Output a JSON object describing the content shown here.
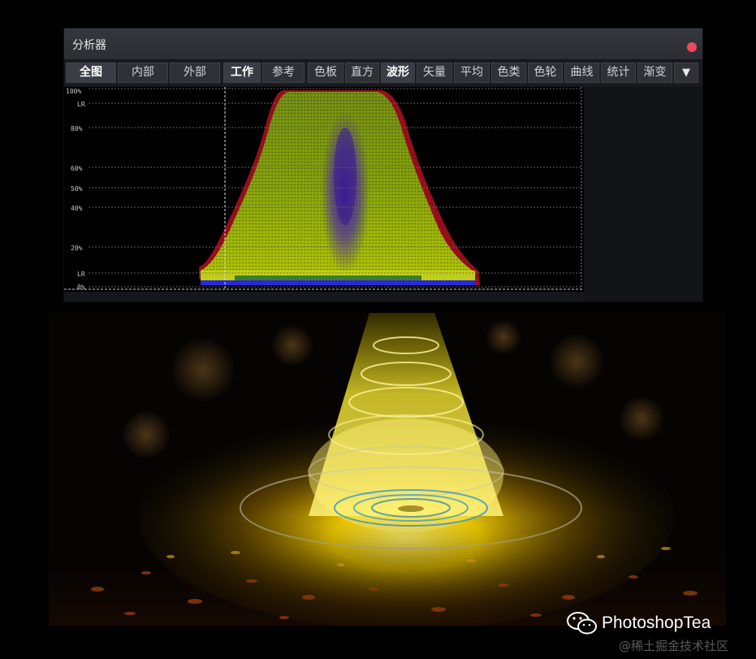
{
  "window": {
    "title": "分析器",
    "close_color": "#ec4a59"
  },
  "tabs": [
    {
      "label": "全图",
      "active": true
    },
    {
      "label": "内部",
      "active": false
    },
    {
      "label": "外部",
      "active": false
    },
    {
      "label": "工作",
      "active": true
    },
    {
      "label": "参考",
      "active": false
    },
    {
      "label": "色板",
      "active": false
    },
    {
      "label": "直方",
      "active": false
    },
    {
      "label": "波形",
      "active": true
    },
    {
      "label": "矢量",
      "active": false
    },
    {
      "label": "平均",
      "active": false
    },
    {
      "label": "色类",
      "active": false
    },
    {
      "label": "色轮",
      "active": false
    },
    {
      "label": "曲线",
      "active": false
    },
    {
      "label": "统计",
      "active": false
    },
    {
      "label": "渐变",
      "active": false
    }
  ],
  "menu_symbol": "▼",
  "scope": {
    "grid_labels": [
      {
        "label": "100%",
        "value": 100
      },
      {
        "label": "LR",
        "value": 95
      },
      {
        "label": "80%",
        "value": 80
      },
      {
        "label": "60%",
        "value": 60
      },
      {
        "label": "50%",
        "value": 50
      },
      {
        "label": "40%",
        "value": 40
      },
      {
        "label": "20%",
        "value": 20
      },
      {
        "label": "LR",
        "value": 5
      },
      {
        "label": "0%",
        "value": 0
      }
    ]
  },
  "watermark": {
    "brand": "PhotoshopTea",
    "site": "@稀土掘金技术社区",
    "icon": "wechat-icon"
  },
  "colors": {
    "waveform_fill": "#8fb400",
    "waveform_edge": "#c0101a",
    "waveform_core": "#5020a0",
    "glow": "#ffe400"
  }
}
